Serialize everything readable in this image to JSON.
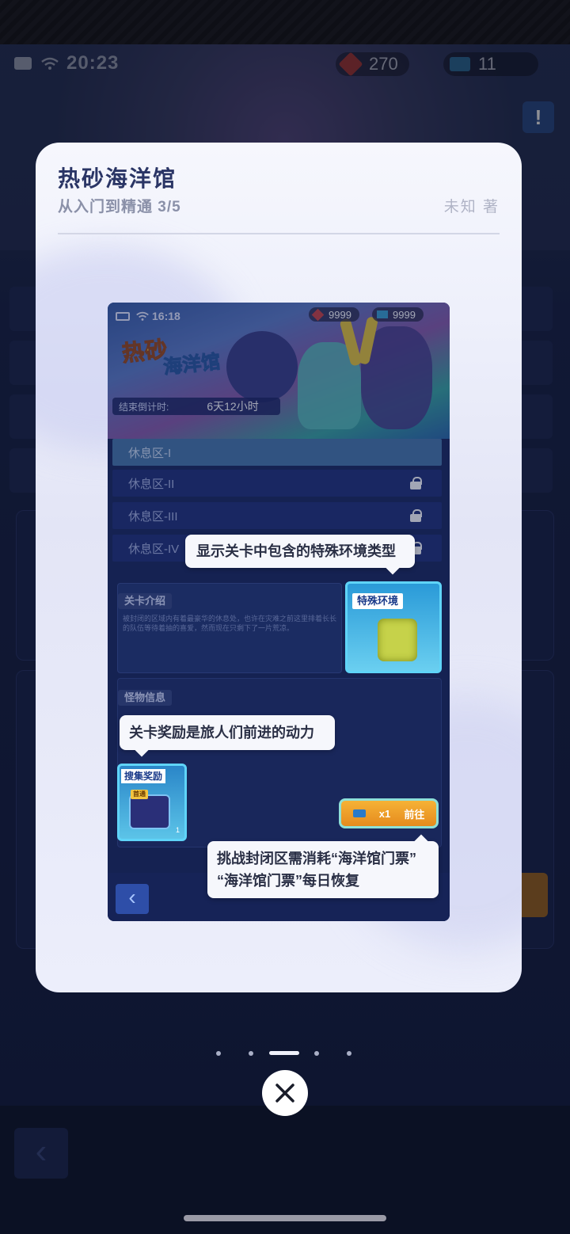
{
  "status_bar": {
    "time": "20:23"
  },
  "currency": {
    "gems": "270",
    "tickets": "11"
  },
  "modal": {
    "title": "热砂海洋馆",
    "subtitle": "从入门到精通 3/5",
    "author": "未知 著"
  },
  "tutorial_screenshot": {
    "status": {
      "time": "16:18",
      "gems": "9999",
      "tickets": "9999"
    },
    "banner": {
      "logo_line1": "热砂",
      "logo_line2": "海洋馆",
      "countdown_label": "结束倒计时:",
      "countdown_value": "6天12小时"
    },
    "zones": [
      {
        "label": "休息区-I",
        "locked": false
      },
      {
        "label": "休息区-II",
        "locked": true
      },
      {
        "label": "休息区-III",
        "locked": true
      },
      {
        "label": "休息区-IV",
        "locked": true
      }
    ],
    "intro_tag": "关卡介绍",
    "intro_text": "被封闭的区域内有着最豪华的休息处，也许在灾难之前这里排着长长的队伍等待着抽的喜爱，然而现在只剩下了一片荒凉。",
    "env_tag": "特殊环境",
    "monster_tag": "怪物信息",
    "reward_tag": "搜集奖励",
    "reward_first": "首通",
    "reward_count": "1",
    "goto_count": "x1",
    "goto_label": "前往"
  },
  "callouts": {
    "env": "显示关卡中包含的特殊环境类型",
    "reward": "关卡奖励是旅人们前进的动力",
    "ticket_line1": "挑战封闭区需消耗“海洋馆门票”",
    "ticket_line2": "“海洋馆门票”每日恢复"
  },
  "pager": {
    "total": 5,
    "current": 3
  },
  "colors": {
    "card_bg": "#eef0fb",
    "title": "#2a3565",
    "accent_orange": "#f6b236",
    "accent_cyan": "#5fd4f8"
  }
}
